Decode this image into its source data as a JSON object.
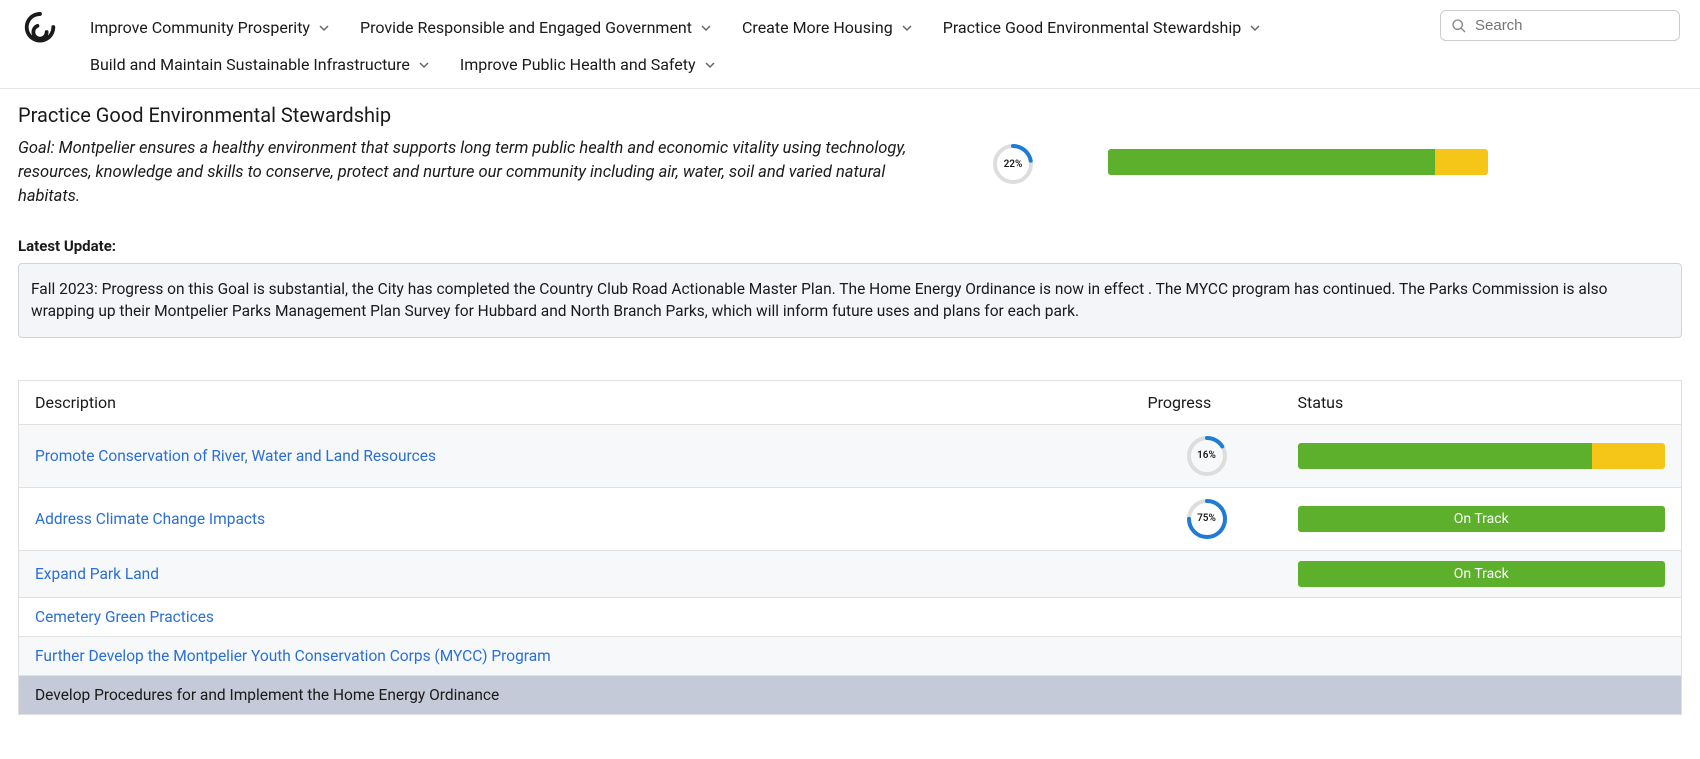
{
  "nav": [
    "Improve Community Prosperity",
    "Provide Responsible and Engaged Government",
    "Create More Housing",
    "Practice Good Environmental Stewardship",
    "Build and Maintain Sustainable Infrastructure",
    "Improve Public Health and Safety"
  ],
  "search": {
    "placeholder": "Search"
  },
  "page_title": "Practice Good Environmental Stewardship",
  "goal_text": "Goal: Montpelier ensures a healthy environment that supports long term public health and economic vitality using technology, resources, knowledge and skills to conserve, protect and nurture our community including air, water, soil and varied natural habitats.",
  "overall_progress_pct": "22%",
  "overall_progress_value": 22,
  "overall_status": {
    "green_pct": 86,
    "yellow_pct": 14
  },
  "latest_update_label": "Latest Update:",
  "latest_update_text": "Fall 2023: Progress on this Goal is substantial, the City has completed the Country Club Road Actionable Master Plan. The Home Energy Ordinance is now in effect . The MYCC program has continued. The Parks Commission is also wrapping up their Montpelier Parks Management Plan Survey for Hubbard and North Branch Parks, which will inform future uses and plans for each park.",
  "table": {
    "headers": {
      "desc": "Description",
      "progress": "Progress",
      "status": "Status"
    },
    "rows": [
      {
        "desc": "Promote Conservation of River, Water and Land Resources",
        "link": true,
        "progress_pct": "16%",
        "progress_value": 16,
        "status_type": "split",
        "green_pct": 80,
        "yellow_pct": 20
      },
      {
        "desc": "Address Climate Change Impacts",
        "link": true,
        "progress_pct": "75%",
        "progress_value": 75,
        "status_type": "ontrack",
        "status_label": "On Track"
      },
      {
        "desc": "Expand Park Land",
        "link": true,
        "progress_pct": "",
        "progress_value": null,
        "status_type": "ontrack",
        "status_label": "On Track"
      },
      {
        "desc": "Cemetery Green Practices",
        "link": true,
        "progress_pct": "",
        "progress_value": null,
        "status_type": "none"
      },
      {
        "desc": "Further Develop the Montpelier Youth Conservation Corps (MYCC) Program",
        "link": true,
        "progress_pct": "",
        "progress_value": null,
        "status_type": "none"
      },
      {
        "desc": "Develop Procedures for and Implement the Home Energy Ordinance",
        "link": false,
        "selected": true,
        "progress_pct": "",
        "progress_value": null,
        "status_type": "none"
      }
    ]
  }
}
